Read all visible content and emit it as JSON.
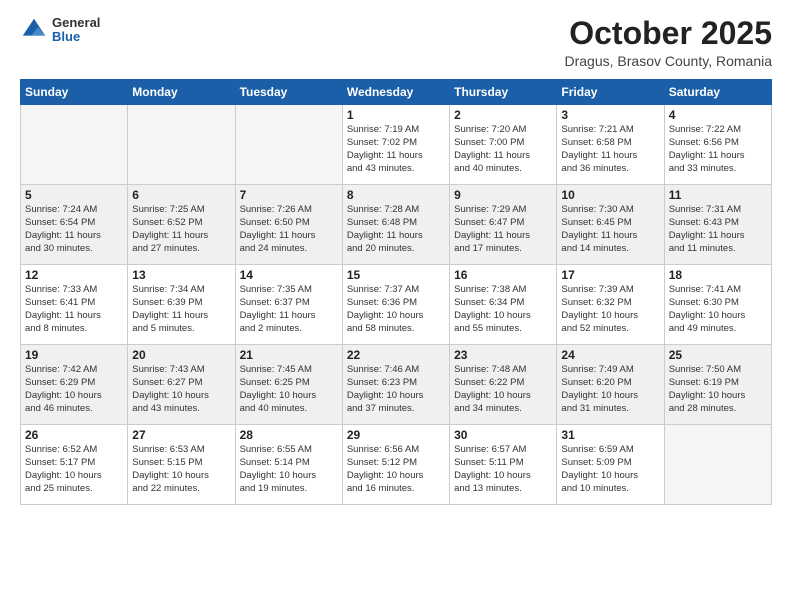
{
  "logo": {
    "general": "General",
    "blue": "Blue"
  },
  "header": {
    "month": "October 2025",
    "location": "Dragus, Brasov County, Romania"
  },
  "weekdays": [
    "Sunday",
    "Monday",
    "Tuesday",
    "Wednesday",
    "Thursday",
    "Friday",
    "Saturday"
  ],
  "weeks": [
    [
      {
        "day": "",
        "info": ""
      },
      {
        "day": "",
        "info": ""
      },
      {
        "day": "",
        "info": ""
      },
      {
        "day": "1",
        "info": "Sunrise: 7:19 AM\nSunset: 7:02 PM\nDaylight: 11 hours\nand 43 minutes."
      },
      {
        "day": "2",
        "info": "Sunrise: 7:20 AM\nSunset: 7:00 PM\nDaylight: 11 hours\nand 40 minutes."
      },
      {
        "day": "3",
        "info": "Sunrise: 7:21 AM\nSunset: 6:58 PM\nDaylight: 11 hours\nand 36 minutes."
      },
      {
        "day": "4",
        "info": "Sunrise: 7:22 AM\nSunset: 6:56 PM\nDaylight: 11 hours\nand 33 minutes."
      }
    ],
    [
      {
        "day": "5",
        "info": "Sunrise: 7:24 AM\nSunset: 6:54 PM\nDaylight: 11 hours\nand 30 minutes."
      },
      {
        "day": "6",
        "info": "Sunrise: 7:25 AM\nSunset: 6:52 PM\nDaylight: 11 hours\nand 27 minutes."
      },
      {
        "day": "7",
        "info": "Sunrise: 7:26 AM\nSunset: 6:50 PM\nDaylight: 11 hours\nand 24 minutes."
      },
      {
        "day": "8",
        "info": "Sunrise: 7:28 AM\nSunset: 6:48 PM\nDaylight: 11 hours\nand 20 minutes."
      },
      {
        "day": "9",
        "info": "Sunrise: 7:29 AM\nSunset: 6:47 PM\nDaylight: 11 hours\nand 17 minutes."
      },
      {
        "day": "10",
        "info": "Sunrise: 7:30 AM\nSunset: 6:45 PM\nDaylight: 11 hours\nand 14 minutes."
      },
      {
        "day": "11",
        "info": "Sunrise: 7:31 AM\nSunset: 6:43 PM\nDaylight: 11 hours\nand 11 minutes."
      }
    ],
    [
      {
        "day": "12",
        "info": "Sunrise: 7:33 AM\nSunset: 6:41 PM\nDaylight: 11 hours\nand 8 minutes."
      },
      {
        "day": "13",
        "info": "Sunrise: 7:34 AM\nSunset: 6:39 PM\nDaylight: 11 hours\nand 5 minutes."
      },
      {
        "day": "14",
        "info": "Sunrise: 7:35 AM\nSunset: 6:37 PM\nDaylight: 11 hours\nand 2 minutes."
      },
      {
        "day": "15",
        "info": "Sunrise: 7:37 AM\nSunset: 6:36 PM\nDaylight: 10 hours\nand 58 minutes."
      },
      {
        "day": "16",
        "info": "Sunrise: 7:38 AM\nSunset: 6:34 PM\nDaylight: 10 hours\nand 55 minutes."
      },
      {
        "day": "17",
        "info": "Sunrise: 7:39 AM\nSunset: 6:32 PM\nDaylight: 10 hours\nand 52 minutes."
      },
      {
        "day": "18",
        "info": "Sunrise: 7:41 AM\nSunset: 6:30 PM\nDaylight: 10 hours\nand 49 minutes."
      }
    ],
    [
      {
        "day": "19",
        "info": "Sunrise: 7:42 AM\nSunset: 6:29 PM\nDaylight: 10 hours\nand 46 minutes."
      },
      {
        "day": "20",
        "info": "Sunrise: 7:43 AM\nSunset: 6:27 PM\nDaylight: 10 hours\nand 43 minutes."
      },
      {
        "day": "21",
        "info": "Sunrise: 7:45 AM\nSunset: 6:25 PM\nDaylight: 10 hours\nand 40 minutes."
      },
      {
        "day": "22",
        "info": "Sunrise: 7:46 AM\nSunset: 6:23 PM\nDaylight: 10 hours\nand 37 minutes."
      },
      {
        "day": "23",
        "info": "Sunrise: 7:48 AM\nSunset: 6:22 PM\nDaylight: 10 hours\nand 34 minutes."
      },
      {
        "day": "24",
        "info": "Sunrise: 7:49 AM\nSunset: 6:20 PM\nDaylight: 10 hours\nand 31 minutes."
      },
      {
        "day": "25",
        "info": "Sunrise: 7:50 AM\nSunset: 6:19 PM\nDaylight: 10 hours\nand 28 minutes."
      }
    ],
    [
      {
        "day": "26",
        "info": "Sunrise: 6:52 AM\nSunset: 5:17 PM\nDaylight: 10 hours\nand 25 minutes."
      },
      {
        "day": "27",
        "info": "Sunrise: 6:53 AM\nSunset: 5:15 PM\nDaylight: 10 hours\nand 22 minutes."
      },
      {
        "day": "28",
        "info": "Sunrise: 6:55 AM\nSunset: 5:14 PM\nDaylight: 10 hours\nand 19 minutes."
      },
      {
        "day": "29",
        "info": "Sunrise: 6:56 AM\nSunset: 5:12 PM\nDaylight: 10 hours\nand 16 minutes."
      },
      {
        "day": "30",
        "info": "Sunrise: 6:57 AM\nSunset: 5:11 PM\nDaylight: 10 hours\nand 13 minutes."
      },
      {
        "day": "31",
        "info": "Sunrise: 6:59 AM\nSunset: 5:09 PM\nDaylight: 10 hours\nand 10 minutes."
      },
      {
        "day": "",
        "info": ""
      }
    ]
  ]
}
